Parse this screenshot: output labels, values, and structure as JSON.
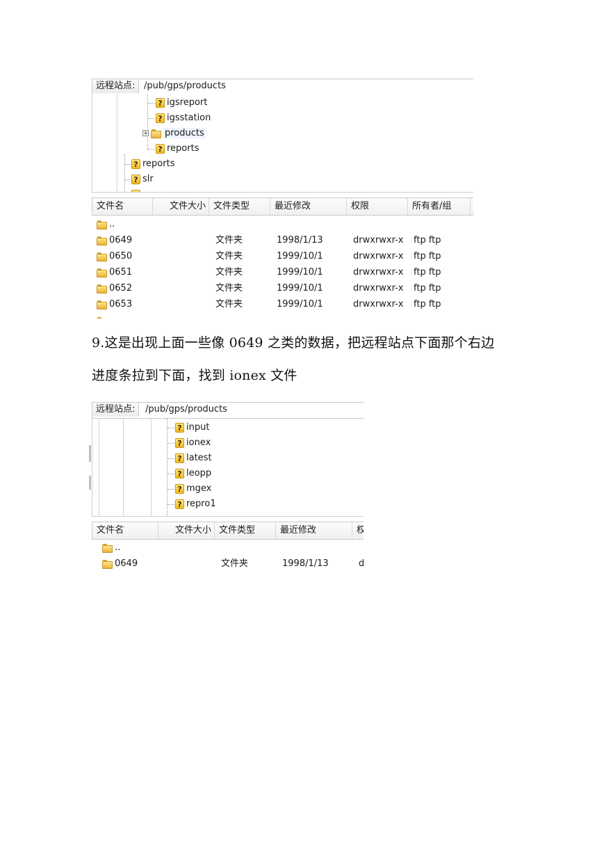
{
  "screenshot_top": {
    "site_label": "远程站点:",
    "path": "/pub/gps/products",
    "tree": [
      {
        "label": "igsreport",
        "icon": "question-icon"
      },
      {
        "label": "igsstation",
        "icon": "question-icon"
      },
      {
        "label": "products",
        "icon": "folder-icon",
        "expander": "+"
      },
      {
        "label": "reports",
        "icon": "question-icon"
      },
      {
        "label": "reports",
        "icon": "question-icon"
      },
      {
        "label": "slr",
        "icon": "question-icon"
      }
    ],
    "columns": [
      "文件名",
      "文件大小",
      "文件类型",
      "最近修改",
      "权限",
      "所有者/组"
    ],
    "rows": [
      {
        "name": "..",
        "type": "",
        "modified": "",
        "perm": "",
        "owner": ""
      },
      {
        "name": "0649",
        "type": "文件夹",
        "modified": "1998/1/13",
        "perm": "drwxrwxr-x",
        "owner": "ftp ftp"
      },
      {
        "name": "0650",
        "type": "文件夹",
        "modified": "1999/10/1",
        "perm": "drwxrwxr-x",
        "owner": "ftp ftp"
      },
      {
        "name": "0651",
        "type": "文件夹",
        "modified": "1999/10/1",
        "perm": "drwxrwxr-x",
        "owner": "ftp ftp"
      },
      {
        "name": "0652",
        "type": "文件夹",
        "modified": "1999/10/1",
        "perm": "drwxrwxr-x",
        "owner": "ftp ftp"
      },
      {
        "name": "0653",
        "type": "文件夹",
        "modified": "1999/10/1",
        "perm": "drwxrwxr-x",
        "owner": "ftp ftp"
      }
    ]
  },
  "paragraph": {
    "line1": "9.这是出现上面一些像 0649 之类的数据，把远程站点下面那个右边",
    "line2": "进度条拉到下面，找到 ionex 文件"
  },
  "screenshot_bottom": {
    "site_label": "远程站点:",
    "path": "/pub/gps/products",
    "tree": [
      {
        "label": "input",
        "icon": "question-icon"
      },
      {
        "label": "ionex",
        "icon": "question-icon"
      },
      {
        "label": "latest",
        "icon": "question-icon"
      },
      {
        "label": "leopp",
        "icon": "question-icon"
      },
      {
        "label": "mgex",
        "icon": "question-icon"
      },
      {
        "label": "repro1",
        "icon": "question-icon"
      }
    ],
    "columns": [
      "文件名",
      "文件大小",
      "文件类型",
      "最近修改",
      "权"
    ],
    "rows": [
      {
        "name": "..",
        "type": "",
        "modified": "",
        "perm": ""
      },
      {
        "name": "0649",
        "type": "文件夹",
        "modified": "1998/1/13",
        "perm": "d"
      }
    ]
  }
}
